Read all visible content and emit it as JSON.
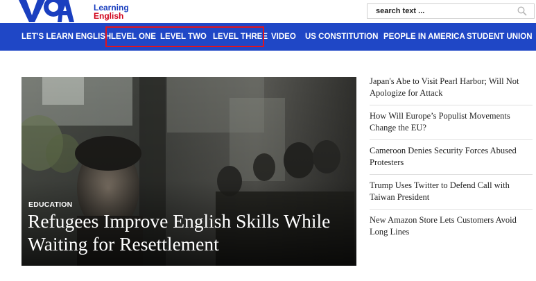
{
  "brand": {
    "line1": "Learning",
    "line2": "English"
  },
  "search": {
    "placeholder": "search text ..."
  },
  "nav": {
    "items": [
      {
        "label": "LET'S LEARN ENGLISH"
      },
      {
        "label": "LEVEL ONE"
      },
      {
        "label": "LEVEL TWO"
      },
      {
        "label": "LEVEL THREE"
      },
      {
        "label": "VIDEO"
      },
      {
        "label": "US CONSTITUTION"
      },
      {
        "label": "PEOPLE IN AMERICA"
      },
      {
        "label": "STUDENT UNION"
      }
    ]
  },
  "hero": {
    "category": "EDUCATION",
    "title": "Refugees Improve English Skills While Waiting for Resettlement"
  },
  "headlines": [
    {
      "title": "Japan's Abe to Visit Pearl Harbor; Will Not Apologize for Attack"
    },
    {
      "title": "How Will Europe’s Populist Movements Change the EU?"
    },
    {
      "title": "Cameroon Denies Security Forces Abused Protesters"
    },
    {
      "title": "Trump Uses Twitter to Defend Call with Taiwan President"
    },
    {
      "title": "New Amazon Store Lets Customers Avoid Long Lines"
    }
  ],
  "colors": {
    "nav_bg": "#1f47c6",
    "highlight": "#e0141e",
    "brand_blue": "#1a3fbf",
    "brand_red": "#d0021b"
  }
}
